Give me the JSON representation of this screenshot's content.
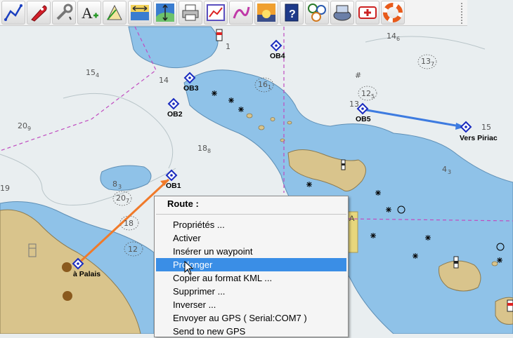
{
  "toolbar": {
    "tools": [
      {
        "name": "route-icon"
      },
      {
        "name": "boat-icon"
      },
      {
        "name": "wrench-settings-icon"
      },
      {
        "name": "text-annotation-icon"
      },
      {
        "name": "measure-angle-icon"
      },
      {
        "name": "zoom-horizontal-icon"
      },
      {
        "name": "zoom-vertical-icon"
      },
      {
        "name": "printer-icon"
      },
      {
        "name": "chart-graph-icon"
      },
      {
        "name": "track-draw-icon"
      },
      {
        "name": "sunset-icon"
      },
      {
        "name": "help-book-icon"
      },
      {
        "name": "instruments-icon"
      },
      {
        "name": "gps-receiver-icon"
      },
      {
        "name": "emergency-icon"
      },
      {
        "name": "lifebuoy-icon"
      }
    ]
  },
  "chart": {
    "waypoints": {
      "ob1": "OB1",
      "ob2": "OB2",
      "ob3": "OB3",
      "ob4": "OB4",
      "ob5": "OB5",
      "vers_piriac": "Vers Piriac",
      "a_palais": "à Palais"
    },
    "depths": {
      "d154": "15",
      "d154s": "4",
      "d146": "14",
      "d146s": "6",
      "d14": "14",
      "d1": "1",
      "d13": "13",
      "d15": "15",
      "d188": "18",
      "d188s": "8",
      "d43": "4",
      "d43s": "3",
      "d209": "20",
      "d209s": "9",
      "d19": "19",
      "d83": "8",
      "d83s": "3",
      "d161": "16",
      "d161s": "1",
      "d137": "13",
      "d137s": "7",
      "d125": "12",
      "d125s": "5",
      "d207": "20",
      "d207s": "7",
      "d18": "18",
      "d12": "12",
      "d16": "16"
    },
    "colors": {
      "deep_water": "#e8eef0",
      "shallow_water": "#8fc2e8",
      "land": "#d9c48c",
      "route_active": "#f07a2a",
      "route_other": "#3d7be0",
      "waypoint": "#1a2bbf",
      "boundary": "#c04cc0"
    }
  },
  "context_menu": {
    "title": "Route :",
    "items": [
      "Propriétés ...",
      "Activer",
      "Insérer un waypoint",
      "Prolonger",
      "Copier au format KML ...",
      "Supprimer ...",
      "Inverser ...",
      "Envoyer au GPS ( Serial:COM7 )",
      "Send to new GPS"
    ],
    "highlighted_index": 3
  }
}
